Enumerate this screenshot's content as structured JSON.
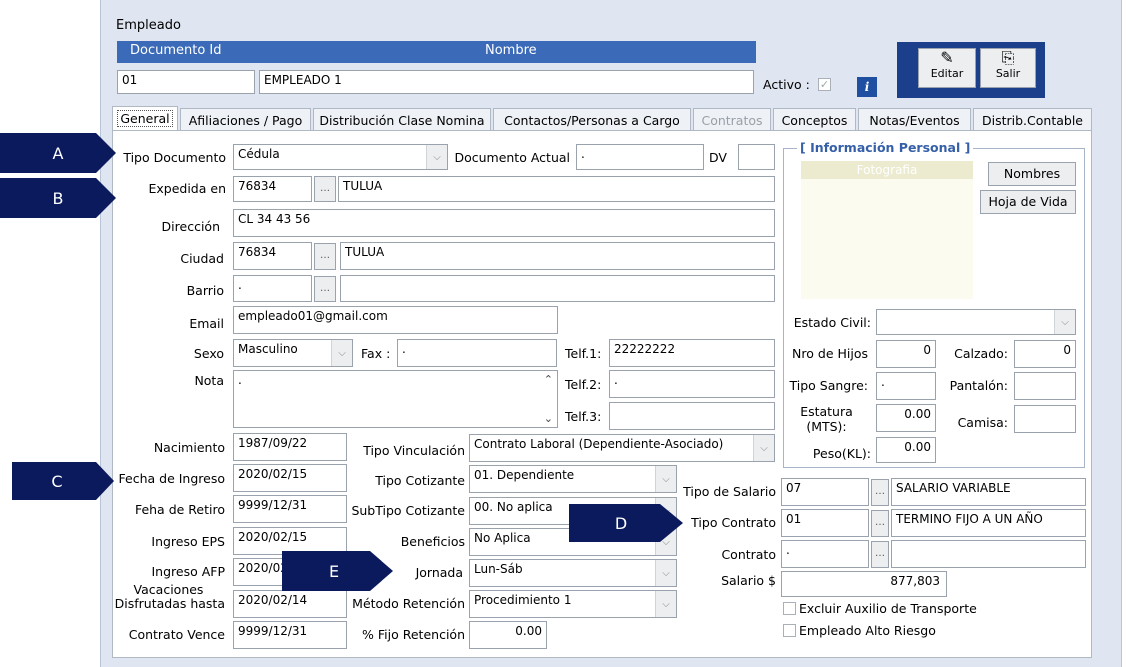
{
  "window": {
    "title": "Empleado"
  },
  "header": {
    "doc_id_label": "Documento Id",
    "nombre_label": "Nombre",
    "doc_id_value": "01",
    "nombre_value": "EMPLEADO 1",
    "activo_label": "Activo :",
    "info_icon_glyph": "i",
    "editar_label": "Editar",
    "salir_label": "Salir"
  },
  "tabs": [
    "General",
    "Afiliaciones / Pago",
    "Distribución Clase Nomina",
    "Contactos/Personas a Cargo",
    "Contratos",
    "Conceptos",
    "Notas/Eventos",
    "Distrib.Contable"
  ],
  "callouts": {
    "a": "A",
    "b": "B",
    "c": "C",
    "d": "D",
    "e": "E"
  },
  "general": {
    "tipo_documento_label": "Tipo Documento",
    "tipo_documento_value": "Cédula",
    "documento_actual_label": "Documento Actual",
    "documento_actual_value": ".",
    "dv_label": "DV",
    "dv_value": "",
    "expedida_label": "Expedida en",
    "expedida_code": "76834",
    "expedida_city": "TULUA",
    "direccion_label": "Dirección",
    "direccion_value": "CL 34 43 56",
    "ciudad_label": "Ciudad",
    "ciudad_code": "76834",
    "ciudad_city": "TULUA",
    "barrio_label": "Barrio",
    "barrio_code": ".",
    "barrio_name": "",
    "email_label": "Email",
    "email_value": "empleado01@gmail.com",
    "sexo_label": "Sexo",
    "sexo_value": "Masculino",
    "fax_label": "Fax :",
    "fax_value": ".",
    "telf1_label": "Telf.1:",
    "telf1_value": "22222222",
    "nota_label": "Nota",
    "nota_value": ".",
    "telf2_label": "Telf.2:",
    "telf2_value": ".",
    "telf3_label": "Telf.3:",
    "telf3_value": "",
    "nacimiento_label": "Nacimiento",
    "nacimiento_value": "1987/09/22",
    "fecha_ingreso_label": "Fecha de Ingreso",
    "fecha_ingreso_value": "2020/02/15",
    "fecha_retiro_label": "Feha de Retiro",
    "fecha_retiro_value": "9999/12/31",
    "ingreso_eps_label": "Ingreso EPS",
    "ingreso_eps_value": "2020/02/15",
    "ingreso_afp_label": "Ingreso AFP",
    "ingreso_afp_value": "2020/02/15",
    "vacaciones_label_1": "Vacaciones",
    "vacaciones_label_2": "Disfrutadas hasta",
    "vacaciones_value": "2020/02/14",
    "contrato_vence_label": "Contrato Vence",
    "contrato_vence_value": "9999/12/31",
    "tipo_vinculacion_label": "Tipo Vinculación",
    "tipo_vinculacion_value": "Contrato Laboral (Dependiente-Asociado)",
    "tipo_cotizante_label": "Tipo Cotizante",
    "tipo_cotizante_value": "01. Dependiente",
    "subtipo_cotizante_label": "SubTipo Cotizante",
    "subtipo_cotizante_value": "00. No aplica",
    "beneficios_label": "Beneficios",
    "beneficios_value": "No Aplica",
    "jornada_label": "Jornada",
    "jornada_value": "Lun-Sáb",
    "metodo_retencion_label": "Método Retención",
    "metodo_retencion_value": "Procedimiento 1",
    "fijo_retencion_label": "% Fijo Retención",
    "fijo_retencion_value": "0.00",
    "tipo_salario_label": "Tipo de Salario",
    "tipo_salario_code": "07",
    "tipo_salario_name": "SALARIO VARIABLE",
    "tipo_contrato_label": "Tipo Contrato",
    "tipo_contrato_code": "01",
    "tipo_contrato_name": "TERMINO FIJO A UN AÑO",
    "contrato_label": "Contrato",
    "contrato_code": ".",
    "contrato_name": "",
    "salario_label": "Salario $",
    "salario_value": "877,803",
    "excluir_auxilio_label": "Excluir Auxilio de Transporte",
    "alto_riesgo_label": "Empleado Alto Riesgo"
  },
  "personal": {
    "group_title": "[ Información Personal ]",
    "fotografia_label": "Fotografia",
    "nombres_button": "Nombres",
    "hoja_vida_button": "Hoja de Vida",
    "estado_civil_label": "Estado Civil:",
    "estado_civil_value": "",
    "nro_hijos_label": "Nro de Hijos",
    "nro_hijos_value": "0",
    "calzado_label": "Calzado:",
    "calzado_value": "0",
    "tipo_sangre_label": "Tipo Sangre:",
    "tipo_sangre_value": ".",
    "pantalon_label": "Pantalón:",
    "pantalon_value": "",
    "estatura_label_1": "Estatura",
    "estatura_label_2": "(MTS):",
    "estatura_value": "0.00",
    "camisa_label": "Camisa:",
    "camisa_value": "",
    "peso_label": "Peso(KL):",
    "peso_value": "0.00"
  }
}
